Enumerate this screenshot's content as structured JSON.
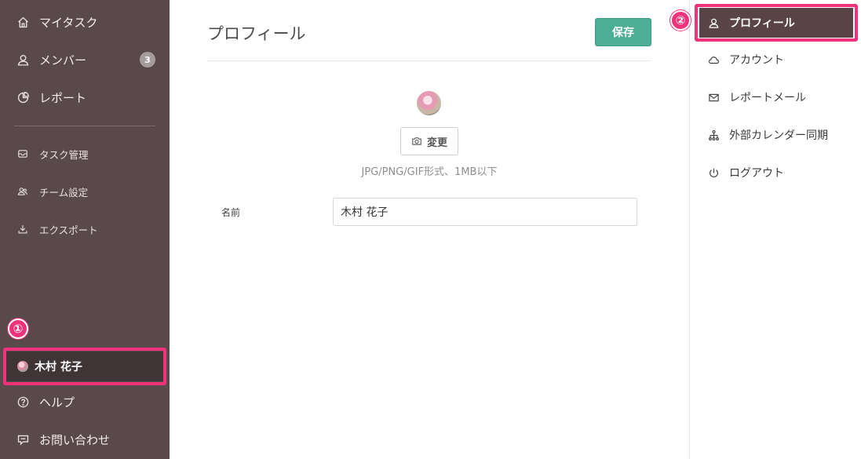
{
  "sidebar": {
    "items": [
      {
        "label": "マイタスク",
        "icon": "home-icon"
      },
      {
        "label": "メンバー",
        "icon": "user-icon",
        "badge": "3"
      },
      {
        "label": "レポート",
        "icon": "pie-chart-icon"
      },
      {
        "label": "タスク管理",
        "icon": "inbox-icon"
      },
      {
        "label": "チーム設定",
        "icon": "team-icon"
      },
      {
        "label": "エクスポート",
        "icon": "download-icon"
      }
    ],
    "user": {
      "name": "木村 花子"
    },
    "help": {
      "label": "ヘルプ",
      "icon": "help-icon"
    },
    "contact": {
      "label": "お問い合わせ",
      "icon": "message-icon"
    },
    "marker": "①"
  },
  "main": {
    "title": "プロフィール",
    "save_label": "保存",
    "change_label": "変更",
    "hint": "JPG/PNG/GIF形式、1MB以下",
    "name_label": "名前",
    "name_value": "木村 花子"
  },
  "settings_menu": {
    "marker": "②",
    "items": [
      {
        "label": "プロフィール",
        "icon": "user-icon",
        "active": true
      },
      {
        "label": "アカウント",
        "icon": "cloud-icon"
      },
      {
        "label": "レポートメール",
        "icon": "mail-icon"
      },
      {
        "label": "外部カレンダー同期",
        "icon": "sitemap-icon"
      },
      {
        "label": "ログアウト",
        "icon": "power-icon"
      }
    ]
  },
  "colors": {
    "sidebar_bg": "#59494b",
    "accent_green": "#4cae94",
    "highlight_pink": "#f0327a",
    "active_item_bg": "#584447"
  }
}
